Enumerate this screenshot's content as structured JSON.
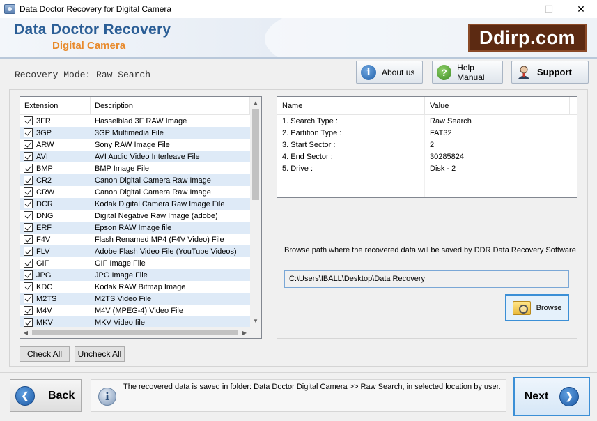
{
  "window": {
    "title": "Data Doctor Recovery for Digital Camera",
    "minimize": "—",
    "maximize": "☐",
    "close": "✕"
  },
  "header": {
    "brand_title": "Data Doctor Recovery",
    "brand_subtitle": "Digital Camera",
    "logo": "Ddirp.com"
  },
  "mode": {
    "label": "Recovery Mode: Raw Search"
  },
  "toolbar": {
    "about_label": "About us",
    "help_label": "Help Manual",
    "support_label": "Support"
  },
  "extensions": {
    "columns": [
      "Extension",
      "Description"
    ],
    "rows": [
      {
        "ext": "3FR",
        "desc": "Hasselblad 3F RAW Image",
        "checked": true
      },
      {
        "ext": "3GP",
        "desc": "3GP Multimedia File",
        "checked": true
      },
      {
        "ext": "ARW",
        "desc": "Sony RAW Image File",
        "checked": true
      },
      {
        "ext": "AVI",
        "desc": "AVI Audio Video Interleave File",
        "checked": true
      },
      {
        "ext": "BMP",
        "desc": "BMP Image File",
        "checked": true
      },
      {
        "ext": "CR2",
        "desc": "Canon Digital Camera Raw Image",
        "checked": true
      },
      {
        "ext": "CRW",
        "desc": "Canon Digital Camera Raw Image",
        "checked": true
      },
      {
        "ext": "DCR",
        "desc": "Kodak Digital Camera Raw Image File",
        "checked": true
      },
      {
        "ext": "DNG",
        "desc": "Digital Negative Raw Image (adobe)",
        "checked": true
      },
      {
        "ext": "ERF",
        "desc": "Epson RAW Image file",
        "checked": true
      },
      {
        "ext": "F4V",
        "desc": "Flash Renamed MP4 (F4V Video) File",
        "checked": true
      },
      {
        "ext": "FLV",
        "desc": "Adobe Flash Video File (YouTube Videos)",
        "checked": true
      },
      {
        "ext": "GIF",
        "desc": "GIF Image File",
        "checked": true
      },
      {
        "ext": "JPG",
        "desc": "JPG Image File",
        "checked": true
      },
      {
        "ext": "KDC",
        "desc": "Kodak RAW Bitmap Image",
        "checked": true
      },
      {
        "ext": "M2TS",
        "desc": "M2TS Video File",
        "checked": true
      },
      {
        "ext": "M4V",
        "desc": "M4V (MPEG-4) Video File",
        "checked": true
      },
      {
        "ext": "MKV",
        "desc": "MKV Video file",
        "checked": true
      }
    ],
    "check_all": "Check All",
    "uncheck_all": "Uncheck All"
  },
  "info": {
    "columns": [
      "Name",
      "Value"
    ],
    "rows": [
      {
        "name": "1. Search Type :",
        "value": "Raw Search"
      },
      {
        "name": "2. Partition Type :",
        "value": "FAT32"
      },
      {
        "name": "3. Start Sector :",
        "value": "2"
      },
      {
        "name": "4. End Sector :",
        "value": "30285824"
      },
      {
        "name": "5. Drive :",
        "value": "Disk - 2"
      }
    ]
  },
  "browse": {
    "label": "Browse path where the recovered data will be saved by DDR Data Recovery Software",
    "path": "C:\\Users\\IBALL\\Desktop\\Data Recovery",
    "button": "Browse"
  },
  "footer": {
    "back": "Back",
    "status": "The recovered data is saved in folder: Data Doctor Digital Camera  >> Raw Search, in selected location by user.",
    "next": "Next"
  }
}
